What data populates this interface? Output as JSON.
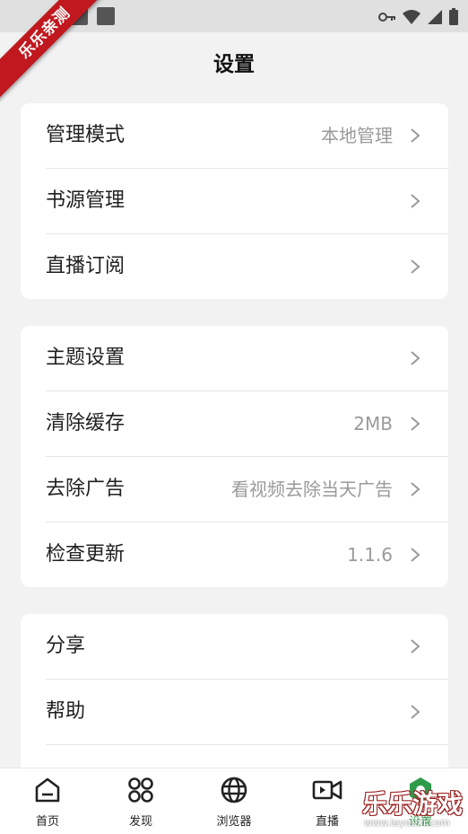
{
  "watermark": {
    "ribbon_text": "乐乐亲测",
    "brand_text": "乐乐游戏",
    "url_text": "www.leyouxi.com"
  },
  "header": {
    "title": "设置"
  },
  "sections": [
    {
      "items": [
        {
          "label": "管理模式",
          "value": "本地管理"
        },
        {
          "label": "书源管理",
          "value": ""
        },
        {
          "label": "直播订阅",
          "value": ""
        }
      ]
    },
    {
      "items": [
        {
          "label": "主题设置",
          "value": ""
        },
        {
          "label": "清除缓存",
          "value": "2MB"
        },
        {
          "label": "去除广告",
          "value": "看视频去除当天广告"
        },
        {
          "label": "检查更新",
          "value": "1.1.6"
        }
      ]
    },
    {
      "items": [
        {
          "label": "分享",
          "value": ""
        },
        {
          "label": "帮助",
          "value": ""
        }
      ]
    }
  ],
  "tabbar": {
    "items": [
      {
        "label": "首页",
        "icon": "home-icon"
      },
      {
        "label": "发现",
        "icon": "grid-icon"
      },
      {
        "label": "浏览器",
        "icon": "globe-icon"
      },
      {
        "label": "直播",
        "icon": "video-icon"
      },
      {
        "label": "设置",
        "icon": "settings-icon"
      }
    ],
    "active_index": 4
  },
  "colors": {
    "accent": "#2e9b4a",
    "background": "#f2f2f2",
    "card": "#ffffff",
    "value_text": "#9a9a9a",
    "ribbon": "#c0181e"
  }
}
